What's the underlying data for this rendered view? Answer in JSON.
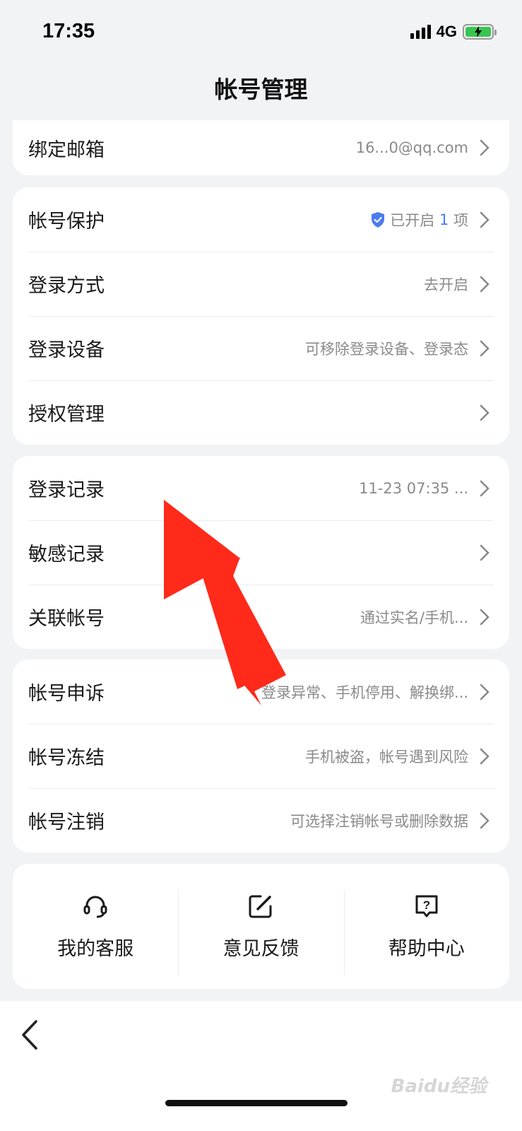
{
  "status": {
    "time": "17:35",
    "network": "4G"
  },
  "nav": {
    "title": "帐号管理"
  },
  "card1": {
    "rows": [
      {
        "label": "绑定邮箱",
        "value": "16...0@qq.com"
      }
    ]
  },
  "card2": {
    "rows": [
      {
        "label": "帐号保护",
        "value_prefix": "已开启 ",
        "value_count": "1",
        "value_suffix": " 项"
      },
      {
        "label": "登录方式",
        "value": "去开启"
      },
      {
        "label": "登录设备",
        "value": "可移除登录设备、登录态"
      },
      {
        "label": "授权管理",
        "value": ""
      }
    ]
  },
  "card3": {
    "rows": [
      {
        "label": "登录记录",
        "value": "11-23 07:35 ..."
      },
      {
        "label": "敏感记录",
        "value": ""
      },
      {
        "label": "关联帐号",
        "value": "通过实名/手机..."
      }
    ]
  },
  "card4": {
    "rows": [
      {
        "label": "帐号申诉",
        "value": "登录异常、手机停用、解换绑..."
      },
      {
        "label": "帐号冻结",
        "value": "手机被盗，帐号遇到风险"
      },
      {
        "label": "帐号注销",
        "value": "可选择注销帐号或删除数据"
      }
    ]
  },
  "tools": [
    {
      "label": "我的客服",
      "icon": "headset-icon"
    },
    {
      "label": "意见反馈",
      "icon": "edit-icon"
    },
    {
      "label": "帮助中心",
      "icon": "help-icon"
    }
  ],
  "watermark": "Baidu经验",
  "colors": {
    "accent": "#4a7cf0",
    "arrow": "#ff2a1a",
    "battery": "#3ac553"
  }
}
